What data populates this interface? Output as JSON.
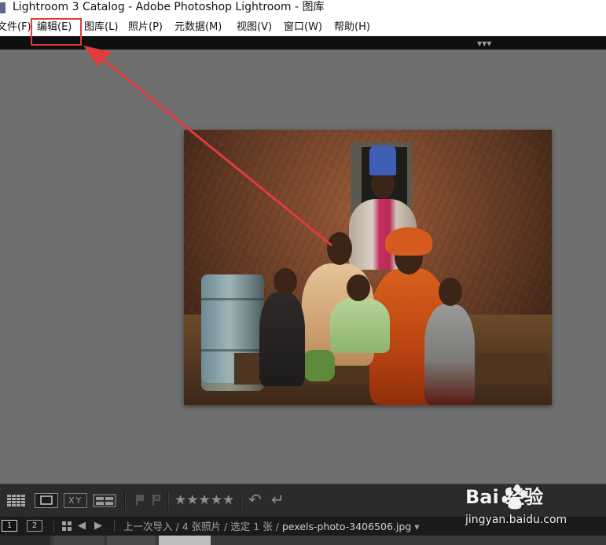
{
  "window": {
    "title": "Lightroom 3 Catalog - Adobe Photoshop Lightroom - 图库"
  },
  "menu": {
    "items": [
      {
        "label": "文件(F)"
      },
      {
        "label": "编辑(E)"
      },
      {
        "label": "图库(L)"
      },
      {
        "label": "照片(P)"
      },
      {
        "label": "元数据(M)"
      },
      {
        "label": "视图(V)"
      },
      {
        "label": "窗口(W)"
      },
      {
        "label": "帮助(H)"
      }
    ],
    "highlighted": "编辑(E)",
    "highlight_color": "#e23b3b"
  },
  "photo": {
    "subject_icon": "family-portrait-photo"
  },
  "toolbar": {
    "view_buttons": [
      "grid-view-icon",
      "loupe-view-icon",
      "compare-view-icon",
      "survey-view-icon"
    ],
    "compare_label": "XY",
    "stars": "★★★★★",
    "rotate_left": "↶",
    "rotate_right": "↵"
  },
  "filmstrip": {
    "screen_1": "1",
    "screen_2": "2",
    "source": "上一次导入",
    "count": "4 张照片",
    "selected": "选定 1 张",
    "file": "pexels-photo-3406506.jpg",
    "dropdown": "▾"
  },
  "watermark": {
    "brand": "Bai  经验",
    "url": "jingyan.baidu.com"
  },
  "colors": {
    "background": "#6f6f6f",
    "toolbar": "#2b2b2b",
    "annotation": "#e23b3b"
  }
}
